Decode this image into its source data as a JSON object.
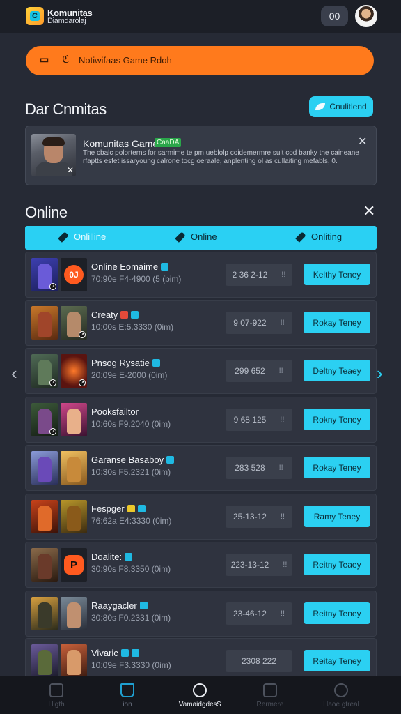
{
  "app": {
    "name": "Komunitas",
    "subtitle": "Diamdarolaj",
    "logo_glyph": "C",
    "count_badge": "00"
  },
  "notice": {
    "text": "Notiwifaas Game Rdoh"
  },
  "discover": {
    "title": "Dar Cnmitas",
    "action_label": "Cnulitlend"
  },
  "featured": {
    "title": "Komunitas Game",
    "tag": "CaaDA",
    "description": "The cbalc polorterns for sarmime te pm ueblolp coidemermre sult cod banky the caineane rfaptts esfet issaryoung calrone tocg oeraale, anplenting ol as cullaiting mefabls, 0."
  },
  "online": {
    "title": "Online",
    "tabs": [
      {
        "label": "Onlilline"
      },
      {
        "label": "Online"
      },
      {
        "label": "Onliting"
      }
    ],
    "rows": [
      {
        "title": "Online Eomaime",
        "sub": "70:90e F4-4900 (5 (bim)",
        "stat_a": "2 36 2-12",
        "stat_b": "!!",
        "button": "Kelthy Teney",
        "badge": "0J"
      },
      {
        "title": "Creaty",
        "sub": "10:00s E:5.3330 (0im)",
        "stat_a": "9 07-922",
        "stat_b": "!!",
        "button": "Rokay Teney"
      },
      {
        "title": "Pnsog Rysatie",
        "sub": "20:09e E-2000 (0im)",
        "stat_a": "299 652",
        "stat_b": "!!",
        "button": "Deltny Teaey"
      },
      {
        "title": "Pooksfailtor",
        "sub": "10:60s F9.2040 (0im)",
        "stat_a": "9 68 125",
        "stat_b": "!!",
        "button": "Rokny Teney"
      },
      {
        "title": "Garanse Basaboy",
        "sub": "10:30s F5.2321 (0im)",
        "stat_a": "283 528",
        "stat_b": "!!",
        "button": "Rokay Teney"
      },
      {
        "title": "Fespger",
        "sub": "76:62a E4:3330 (0im)",
        "stat_a": "25-13-12",
        "stat_b": "!!",
        "button": "Ramy Teney"
      },
      {
        "title": "Doalite:",
        "sub": "30:90s F8.3350 (0im)",
        "stat_a": "223-13-12",
        "stat_b": "!!",
        "button": "Reitny Teaey",
        "badge": "P"
      },
      {
        "title": "Raaygacler",
        "sub": "30:80s F0.2331 (0im)",
        "stat_a": "23-46-12",
        "stat_b": "!!",
        "button": "Reitny Teney"
      },
      {
        "title": "Vivaric",
        "sub": "10:09e F3.3330 (0im)",
        "stat_a": "2308 222",
        "stat_b": "",
        "button": "Reitay Teney"
      }
    ]
  },
  "bottom_nav": [
    {
      "label": "Hlgth",
      "icon": "home-icon"
    },
    {
      "label": "ion",
      "icon": "bookmark-icon"
    },
    {
      "label": "Vamaidgdes$",
      "icon": "compass-icon"
    },
    {
      "label": "Rermere",
      "icon": "square-icon"
    },
    {
      "label": "Haoe gtreal",
      "icon": "profile-icon"
    }
  ],
  "colors": {
    "accent": "#2bd0f2",
    "notice": "#ff7a1c",
    "background": "#262a35"
  }
}
